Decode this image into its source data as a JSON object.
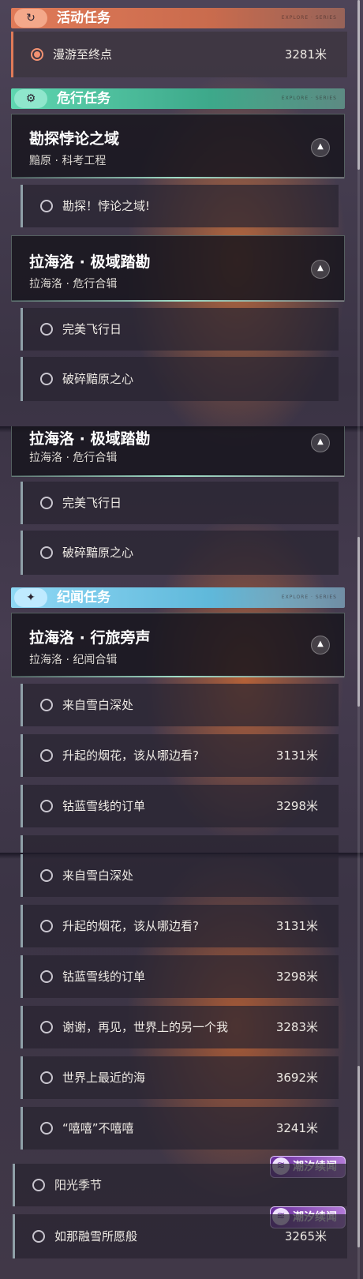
{
  "sections": {
    "activity": "活动任务",
    "danger": "危行任务",
    "chronicle": "纪闻任务",
    "tag": "EXPLORE · SERIES"
  },
  "active_quest": {
    "label": "漫游至终点",
    "distance": "3281米"
  },
  "groups": {
    "kantan": {
      "title": "勘探悖论之域",
      "subtitle": "黯原 · 科考工程"
    },
    "lahailuo_jiyu": {
      "title": "拉海洛 · 极域踏勘",
      "subtitle": "拉海洛 · 危行合辑"
    },
    "lahailuo_xinglu": {
      "title": "拉海洛 · 行旅旁声",
      "subtitle": "拉海洛 · 纪闻合辑"
    }
  },
  "quests": {
    "kantan1": "勘探！悖论之域!",
    "wanmei": "完美飞行日",
    "posui": "破碎黯原之心",
    "laizi": "来自雪白深处",
    "yanhua": "升起的烟花，该从哪边看?",
    "yanhua_dist": "3131米",
    "gulan": "钴蓝雪线的订单",
    "gulan_dist": "3298米",
    "xiexie": "谢谢，再见，世界上的另一个我",
    "xiexie_dist": "3283米",
    "haiyang": "世界上最近的海",
    "haiyang_dist": "3692米",
    "xixi": "“嘻嘻”不嘻嘻",
    "xixi_dist": "3241米",
    "yangguang": "阳光季节",
    "ronxue": "如那融雪所愿般",
    "ronxue_dist": "3265米"
  },
  "badge_label": "潮汐续闻",
  "colors": {
    "activity": "#e07a58",
    "danger": "#5fd6b0",
    "chronicle": "#8fd8f5",
    "badge": "#8a45c0"
  },
  "icons": {
    "activity": "refresh-flag-icon",
    "danger": "gear-eye-icon",
    "chronicle": "sparkle-icon",
    "collapse": "chevron-up-icon",
    "status": "circle-icon",
    "badge": "tide-icon"
  }
}
